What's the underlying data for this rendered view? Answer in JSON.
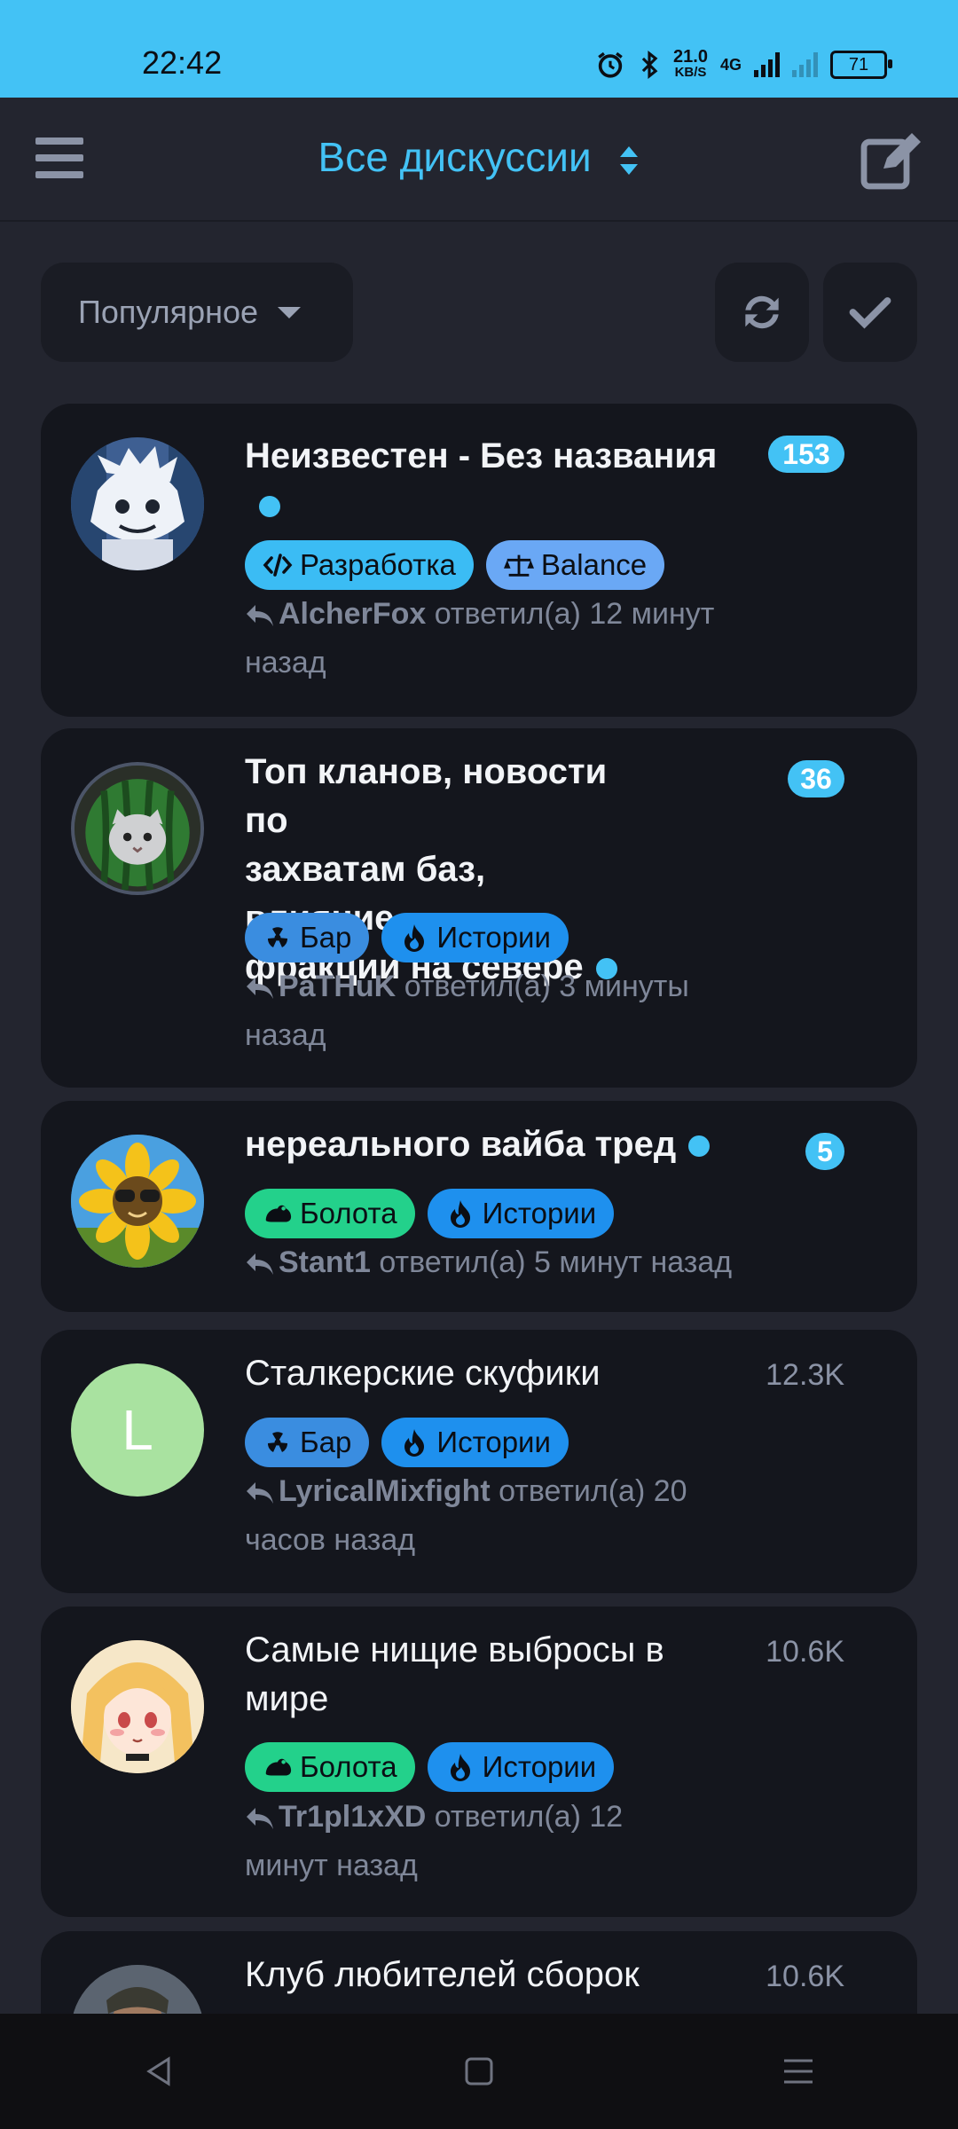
{
  "status_bar": {
    "time": "22:42",
    "net_speed_value": "21.0",
    "net_speed_unit": "KB/S",
    "network": "4G",
    "battery": "71"
  },
  "app_bar": {
    "title": "Все дискуссии"
  },
  "filter": {
    "sort_label": "Популярное"
  },
  "discussions": [
    {
      "title": "Неизвестен - Без названия",
      "unread": true,
      "count": "153",
      "count_highlighted": true,
      "avatar": "anime-avatar-white-hair",
      "tags": [
        {
          "label": "Разработка",
          "icon": "code-icon",
          "color": "#3bbcf4"
        },
        {
          "label": "Balance",
          "icon": "scale-icon",
          "color": "#6aa8f5"
        }
      ],
      "author": "AlcherFox",
      "action": "ответил(а)",
      "time_line1": "12 минут",
      "time_line2": "назад"
    },
    {
      "title_l1": "Топ кланов, новости по",
      "title_l2": "захватам баз, влияние",
      "title_l3": "фракции на севере",
      "unread": true,
      "count": "36",
      "count_highlighted": true,
      "avatar": "cat-in-watermelon-avatar",
      "tags": [
        {
          "label": "Бар",
          "icon": "radiation-icon",
          "color": "#3a8de0"
        },
        {
          "label": "Истории",
          "icon": "fire-icon",
          "color": "#1e90ee"
        }
      ],
      "author": "PaTHuK",
      "action": "ответил(а)",
      "time_line1": "3 минуты",
      "time_line2": "назад"
    },
    {
      "title": "нереального вайба тред",
      "unread": true,
      "count": "5",
      "count_highlighted": true,
      "avatar": "sunflower-avatar",
      "tags": [
        {
          "label": "Болота",
          "icon": "frog-icon",
          "color": "#23d18b"
        },
        {
          "label": "Истории",
          "icon": "fire-icon",
          "color": "#1e90ee"
        }
      ],
      "author": "Stant1",
      "action": "ответил(а)",
      "time_line1": "5 минут назад"
    },
    {
      "title": "Сталкерские скуфики",
      "unread": false,
      "count": "12.3K",
      "count_highlighted": false,
      "avatar_letter": "L",
      "tags": [
        {
          "label": "Бар",
          "icon": "radiation-icon",
          "color": "#3a8de0"
        },
        {
          "label": "Истории",
          "icon": "fire-icon",
          "color": "#1e90ee"
        }
      ],
      "author": "LyricalMixfight",
      "action": "ответил(а)",
      "time_line1": "20",
      "time_line2": "часов назад"
    },
    {
      "title_l1": "Самые нищие выбросы в",
      "title_l2": "мире",
      "unread": false,
      "count": "10.6K",
      "count_highlighted": false,
      "avatar": "anime-girl-avatar",
      "tags": [
        {
          "label": "Болота",
          "icon": "frog-icon",
          "color": "#23d18b"
        },
        {
          "label": "Истории",
          "icon": "fire-icon",
          "color": "#1e90ee"
        }
      ],
      "author": "Tr1pl1xXD",
      "action": "ответил(а)",
      "time_line1": "12",
      "time_line2": "минут назад"
    },
    {
      "title": "Клуб любителей сборок",
      "unread": false,
      "count": "10.6K",
      "count_highlighted": false,
      "avatar": "soldier-avatar"
    }
  ],
  "colors": {
    "accent": "#43c2f5",
    "background": "#23252f",
    "card": "#14161d"
  }
}
